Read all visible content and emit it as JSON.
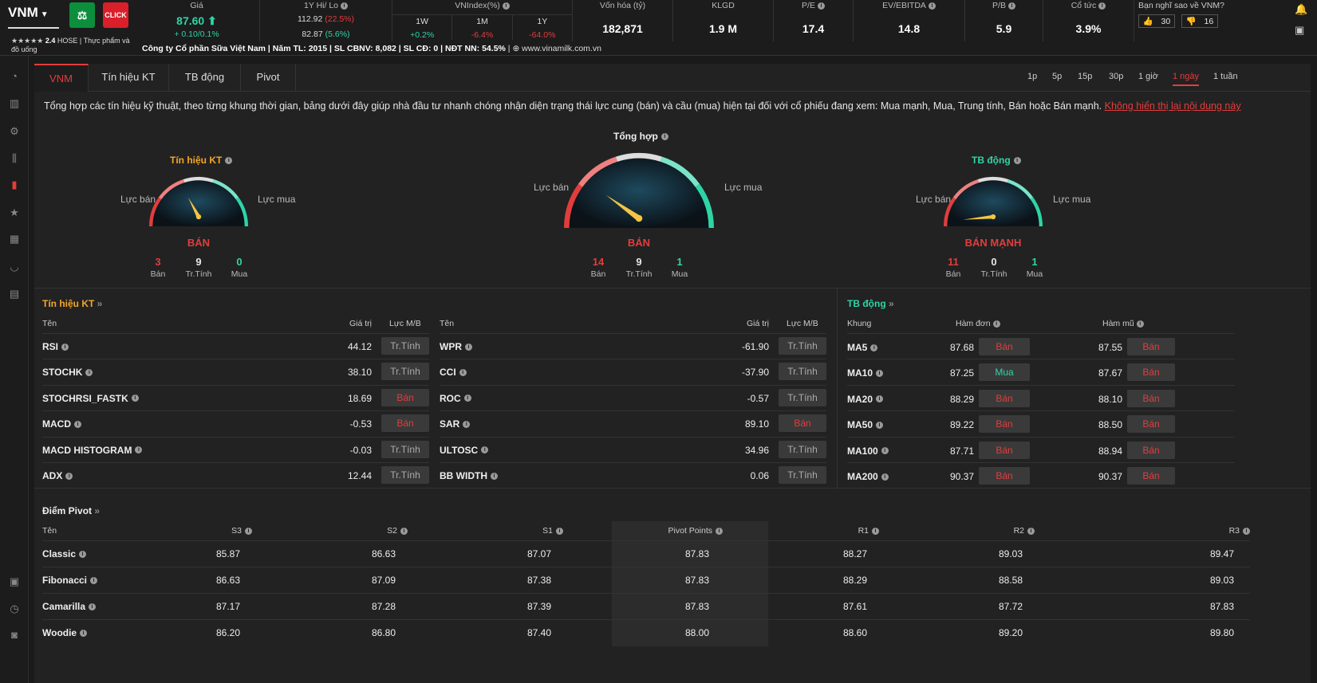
{
  "header": {
    "ticker": "VNM",
    "icon1": "gavel-icon",
    "icon2_label": "CLICK",
    "rating_stars": "★★★★★",
    "rating_score": "2.4",
    "exchange": "HOSE",
    "industry": "Thực phẩm và đồ uống",
    "price_label": "Giá",
    "price": "87.60",
    "price_change": "+ 0.10/0.1%",
    "hilo_label": "1Y Hi/ Lo",
    "hi": "112.92",
    "hi_pct": "(22.5%)",
    "lo": "82.87",
    "lo_pct": "(5.6%)",
    "vnindex_label": "VNIndex(%)",
    "vnindex": [
      {
        "p": "1W",
        "v": "+0.2%"
      },
      {
        "p": "1M",
        "v": "-6.4%"
      },
      {
        "p": "1Y",
        "v": "-64.0%"
      }
    ],
    "metrics": [
      {
        "label": "Vốn hóa (tỷ)",
        "value": "182,871"
      },
      {
        "label": "KLGD",
        "value": "1.9 M"
      },
      {
        "label": "P/E",
        "value": "17.4"
      },
      {
        "label": "EV/EBITDA",
        "value": "14.8"
      },
      {
        "label": "P/B",
        "value": "5.9"
      },
      {
        "label": "Cổ tức",
        "value": "3.9%"
      }
    ],
    "opinion_label": "Bạn nghĩ sao về VNM?",
    "likes": "30",
    "dislikes": "16",
    "company": "Công ty Cổ phần Sữa Việt Nam | Năm TL:",
    "year": "2015",
    "sl_cbnv_label": "| SL CBNV:",
    "sl_cbnv": "8,082",
    "sl_cd_label": "| SL CĐ:",
    "sl_cd": "0",
    "ndt_label": "| NĐT NN:",
    "ndt": "54.5%",
    "website": "| ⊕ www.vinamilk.com.vn"
  },
  "tabs": [
    "VNM",
    "Tín hiệu KT",
    "TB động",
    "Pivot"
  ],
  "timeframes": [
    "1p",
    "5p",
    "15p",
    "30p",
    "1 giờ",
    "1 ngày",
    "1 tuần"
  ],
  "description": "Tổng hợp các tín hiệu kỹ thuật, theo từng khung thời gian, bảng dưới đây giúp nhà đầu tư nhanh chóng nhận diện trạng thái lực cung (bán) và cầu (mua) hiện tại đối với cổ phiếu đang xem: Mua mạnh, Mua, Trung tính, Bán hoặc Bán mạnh.",
  "hide_link": "Không hiển thị lại nội dung này",
  "gauges": {
    "left_label": "Lực bán",
    "right_label": "Lực mua",
    "count_labels": [
      "Bán",
      "Tr.Tính",
      "Mua"
    ],
    "items": [
      {
        "title": "Tín hiệu KT",
        "verdict": "BÁN",
        "sell": "3",
        "neutral": "9",
        "buy": "0",
        "needle": 0.39
      },
      {
        "title": "Tổng hợp",
        "verdict": "BÁN",
        "sell": "14",
        "neutral": "9",
        "buy": "1",
        "needle": 0.25
      },
      {
        "title": "TB động",
        "verdict": "BÁN MẠNH",
        "sell": "11",
        "neutral": "0",
        "buy": "1",
        "needle": 0.07
      }
    ]
  },
  "tech": {
    "title": "Tín hiệu KT",
    "headers": {
      "name": "Tên",
      "value": "Giá trị",
      "force": "Lực M/B"
    },
    "left": [
      [
        "RSI",
        "44.12",
        "Tr.Tính"
      ],
      [
        "STOCHK",
        "38.10",
        "Tr.Tính"
      ],
      [
        "STOCHRSI_FASTK",
        "18.69",
        "Bán"
      ],
      [
        "MACD",
        "-0.53",
        "Bán"
      ],
      [
        "MACD HISTOGRAM",
        "-0.03",
        "Tr.Tính"
      ],
      [
        "ADX",
        "12.44",
        "Tr.Tính"
      ]
    ],
    "right": [
      [
        "WPR",
        "-61.90",
        "Tr.Tính"
      ],
      [
        "CCI",
        "-37.90",
        "Tr.Tính"
      ],
      [
        "ROC",
        "-0.57",
        "Tr.Tính"
      ],
      [
        "SAR",
        "89.10",
        "Bán"
      ],
      [
        "ULTOSC",
        "34.96",
        "Tr.Tính"
      ],
      [
        "BB WIDTH",
        "0.06",
        "Tr.Tính"
      ]
    ]
  },
  "ma": {
    "title": "TB động",
    "headers": {
      "frame": "Khung",
      "simple": "Hàm đơn",
      "exp": "Hàm mũ"
    },
    "rows": [
      [
        "MA5",
        "87.68",
        "Bán",
        "87.55",
        "Bán"
      ],
      [
        "MA10",
        "87.25",
        "Mua",
        "87.67",
        "Bán"
      ],
      [
        "MA20",
        "88.29",
        "Bán",
        "88.10",
        "Bán"
      ],
      [
        "MA50",
        "89.22",
        "Bán",
        "88.50",
        "Bán"
      ],
      [
        "MA100",
        "87.71",
        "Bán",
        "88.94",
        "Bán"
      ],
      [
        "MA200",
        "90.37",
        "Bán",
        "90.37",
        "Bán"
      ]
    ]
  },
  "pivot": {
    "title": "Điểm Pivot",
    "headers": [
      "Tên",
      "S3",
      "S2",
      "S1",
      "Pivot Points",
      "R1",
      "R2",
      "R3"
    ],
    "rows": [
      [
        "Classic",
        "85.87",
        "86.63",
        "87.07",
        "87.83",
        "88.27",
        "89.03",
        "89.47"
      ],
      [
        "Fibonacci",
        "86.63",
        "87.09",
        "87.38",
        "87.83",
        "88.29",
        "88.58",
        "89.03"
      ],
      [
        "Camarilla",
        "87.17",
        "87.28",
        "87.39",
        "87.83",
        "87.61",
        "87.72",
        "87.83"
      ],
      [
        "Woodie",
        "86.20",
        "86.80",
        "87.40",
        "88.00",
        "88.60",
        "89.20",
        "89.80"
      ]
    ]
  },
  "colors": {
    "sell": "#e23d3d",
    "buy": "#2fd4a5",
    "orange": "#f4a62a",
    "neutral": "#aaaaaa"
  }
}
